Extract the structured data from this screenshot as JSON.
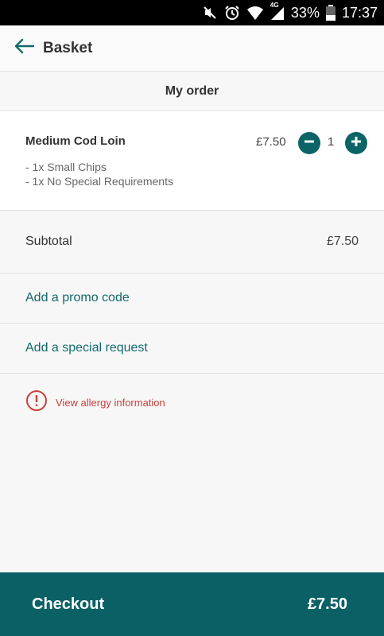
{
  "status_bar": {
    "battery": "33%",
    "time": "17:37",
    "network": "4G",
    "icons": [
      "mute-icon",
      "alarm-icon",
      "wifi-icon",
      "signal-icon",
      "battery-icon"
    ]
  },
  "header": {
    "back_icon": "arrow-left-icon",
    "title": "Basket"
  },
  "section_title": "My order",
  "order_item": {
    "name": "Medium Cod Loin",
    "modifiers": [
      "- 1x Small Chips",
      "- 1x No Special Requirements"
    ],
    "price": "£7.50",
    "quantity": "1"
  },
  "subtotal": {
    "label": "Subtotal",
    "value": "£7.50"
  },
  "links": {
    "promo": "Add a promo code",
    "special_request": "Add a special request"
  },
  "allergy": {
    "icon": "alert-circle-icon",
    "label": "View allergy information"
  },
  "checkout": {
    "label": "Checkout",
    "total": "£7.50"
  },
  "colors": {
    "brand": "#0a6065",
    "link": "#136a6d",
    "warning": "#c9413a"
  }
}
